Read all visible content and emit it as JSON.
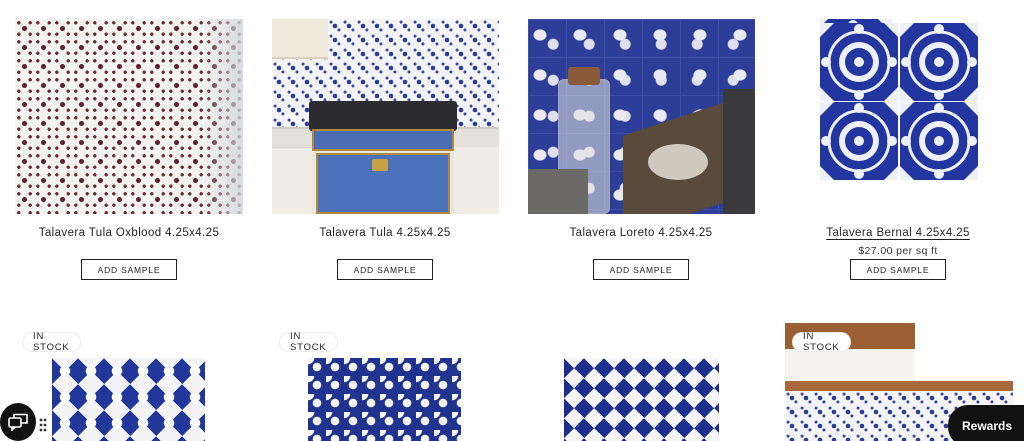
{
  "products_row1": [
    {
      "title": "Talavera Tula Oxblood 4.25x4.25",
      "button": "ADD SAMPLE",
      "image_icon": "tile-photo-oxblood"
    },
    {
      "title": "Talavera Tula 4.25x4.25",
      "button": "ADD SAMPLE",
      "image_icon": "tile-photo-kitchen-range"
    },
    {
      "title": "Talavera Loreto 4.25x4.25",
      "button": "ADD SAMPLE",
      "image_icon": "tile-photo-loreto"
    },
    {
      "title": "Talavera Bernal 4.25x4.25",
      "price": "$27.00 per sq ft",
      "button": "ADD SAMPLE",
      "image_icon": "tile-photo-bernal"
    }
  ],
  "products_row2": [
    {
      "badge": "IN STOCK"
    },
    {
      "badge": "IN STOCK"
    },
    {},
    {
      "badge": "IN STOCK"
    }
  ],
  "widgets": {
    "chat_icon": "chat-bubbles-icon",
    "rewards_label": "Rewards"
  },
  "colors": {
    "talavera_blue": "#23389a",
    "oxblood": "#5e2230",
    "button_border": "#222222"
  }
}
